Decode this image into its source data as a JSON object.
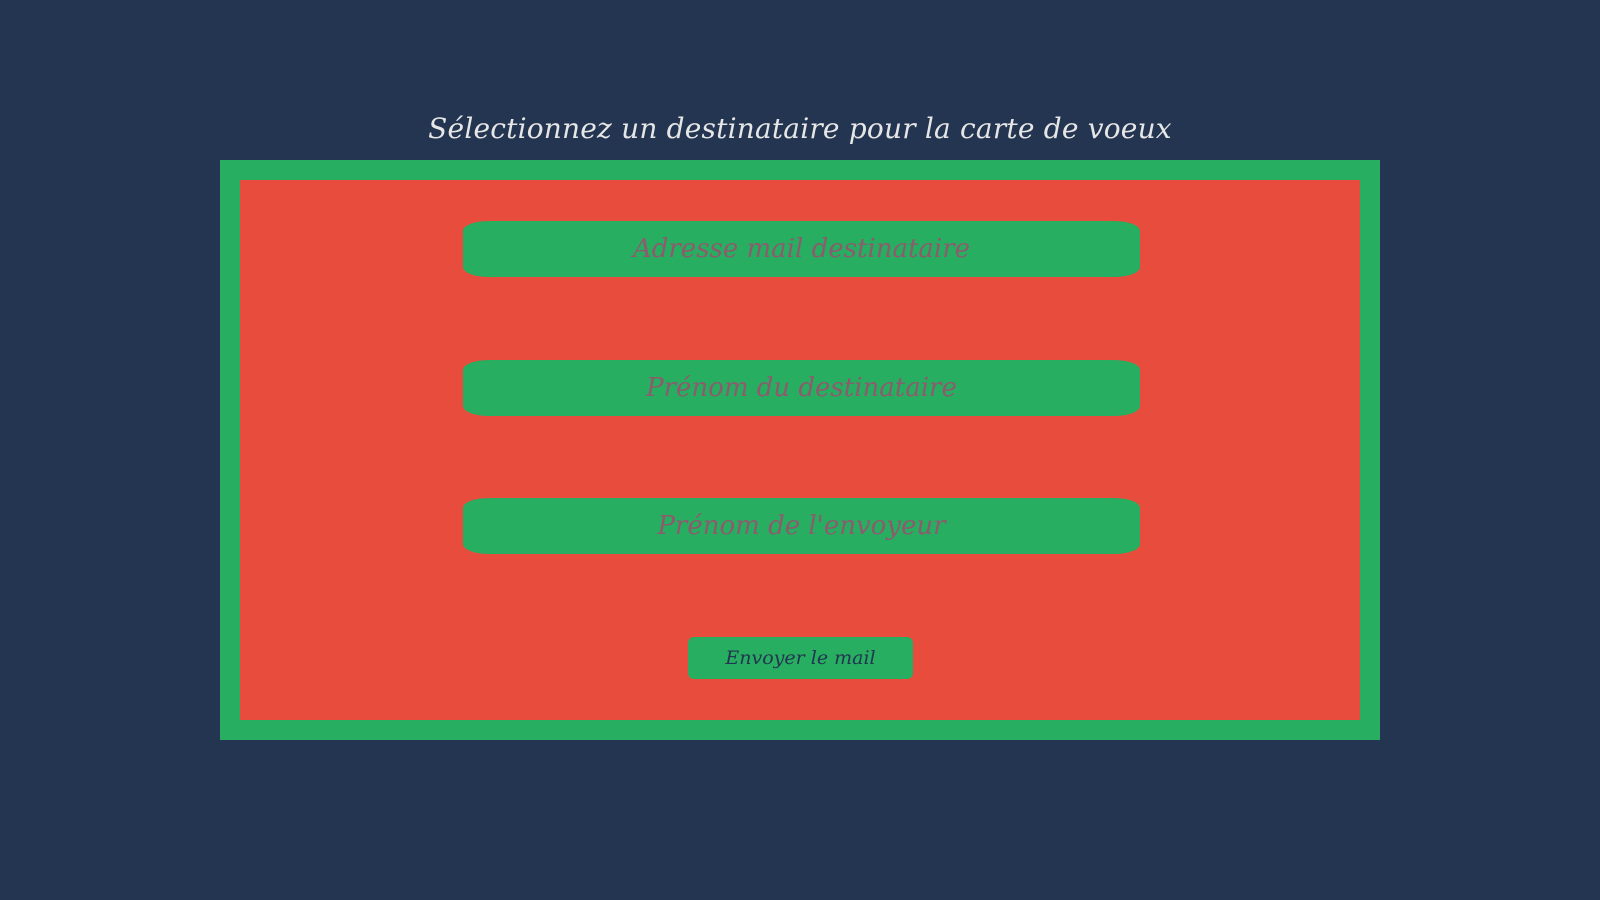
{
  "page": {
    "title": "Sélectionnez un destinataire pour la carte de voeux"
  },
  "form": {
    "email_placeholder": "Adresse mail destinataire",
    "recipient_name_placeholder": "Prénom du destinataire",
    "sender_name_placeholder": "Prénom de l'envoyeur",
    "submit_label": "Envoyer le mail"
  },
  "colors": {
    "background": "#233551",
    "frame": "#27ae60",
    "panel": "#e74c3c",
    "field": "#27ae60",
    "placeholder_text": "#8e5a6e",
    "title_text": "#e6e6e6",
    "button_text": "#233551"
  }
}
